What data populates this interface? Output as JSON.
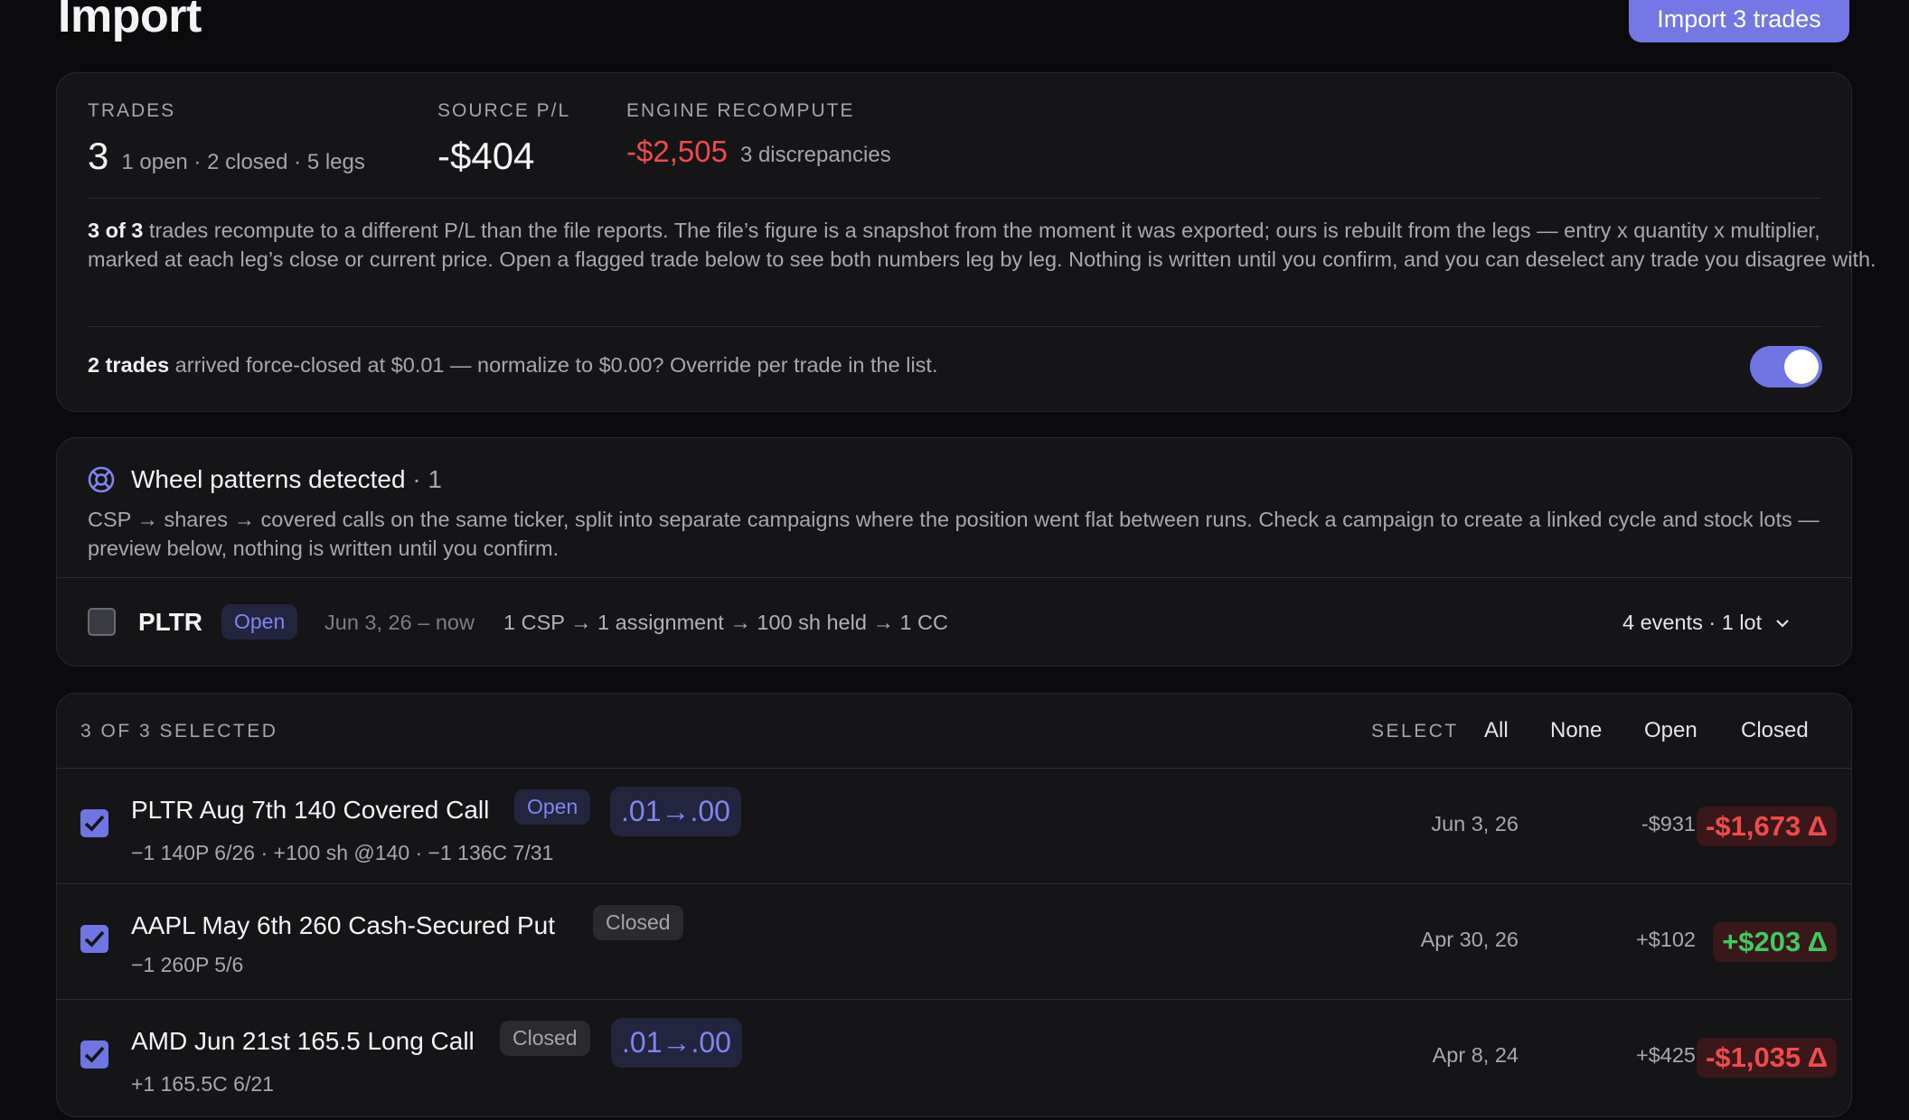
{
  "page": {
    "title": "Import"
  },
  "header": {
    "import_button": "Import 3 trades"
  },
  "summary": {
    "trades": {
      "label": "TRADES",
      "value": "3",
      "sub": "1 open · 2 closed · 5 legs"
    },
    "source_pl": {
      "label": "SOURCE P/L",
      "value": "-$404"
    },
    "engine": {
      "label": "ENGINE RECOMPUTE",
      "value": "-$2,505",
      "sub": "3 discrepancies"
    },
    "explain_bold": "3 of 3",
    "explain_text": " trades recompute to a different P/L than the file reports. The file’s figure is a snapshot from the moment it was exported; ours is rebuilt from the legs — entry x quantity x multiplier, marked at each leg’s close or current price. Open a flagged trade below to see both numbers leg by leg. Nothing is written until you confirm, and you can deselect any trade you disagree with.",
    "force_bold": "2 trades",
    "force_text": " arrived force-closed at $0.01 — normalize to $0.00? Override per trade in the list.",
    "normalize_toggle_on": true,
    "accent_color": "#6f75e3"
  },
  "wheel": {
    "title": "Wheel patterns detected",
    "count": " · 1",
    "description": "CSP → shares → covered calls on the same ticker, split into separate campaigns where the position went flat between runs. Check a campaign to create a linked cycle and stock lots — preview below, nothing is written until you confirm.",
    "campaign": {
      "ticker": "PLTR",
      "status": "Open",
      "range": "Jun 3, 26 – now",
      "flow": "1 CSP → 1 assignment → 100 sh held → 1 CC",
      "events": "4 events · 1 lot",
      "checked": false
    }
  },
  "trades": {
    "selected_count": "3 OF 3 SELECTED",
    "select_label": "SELECT",
    "select_options": [
      "All",
      "None",
      "Open",
      "Closed"
    ],
    "rows": [
      {
        "name": "PLTR Aug 7th 140 Covered Call",
        "status": "Open",
        "normalize": ".01→.00",
        "legs": "−1 140P 6/26 · +100 sh @140 · −1 136C 7/31",
        "date": "Jun 3, 26",
        "source_pl": "-$931",
        "delta": "-$1,673 Δ",
        "checked": true
      },
      {
        "name": "AAPL May 6th 260 Cash-Secured Put",
        "status": "Closed",
        "legs": "−1 260P 5/6",
        "date": "Apr 30, 26",
        "source_pl": "+$102",
        "delta": "+$203 Δ",
        "checked": true
      },
      {
        "name": "AMD Jun 21st 165.5 Long Call",
        "status": "Closed",
        "normalize": ".01→.00",
        "legs": "+1 165.5C 6/21",
        "date": "Apr 8, 24",
        "source_pl": "+$425",
        "delta": "-$1,035 Δ",
        "checked": true
      }
    ]
  }
}
